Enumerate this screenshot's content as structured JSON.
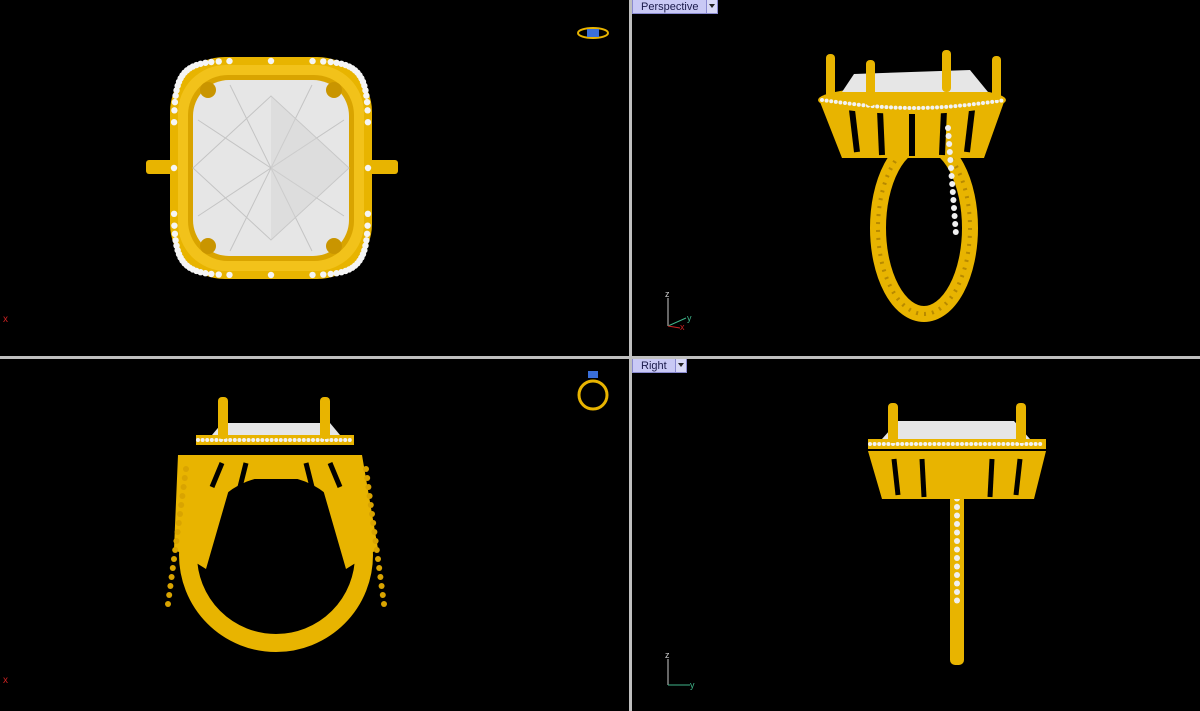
{
  "viewports": {
    "top": {
      "label": "",
      "marker": "x"
    },
    "perspective": {
      "label": "Perspective"
    },
    "front": {
      "label": "",
      "marker": "x"
    },
    "right": {
      "label": "Right"
    }
  },
  "axes": {
    "perspective": {
      "z": "z",
      "y": "y",
      "x": "x"
    },
    "right": {
      "z": "z",
      "y": "y"
    }
  },
  "colors": {
    "background": "#000000",
    "gold": "#E8B400",
    "gold_dark": "#A07800",
    "stone": "#E6E6E6",
    "accent_stone": "#3a6fd8",
    "divider": "#bfbfbf",
    "tab_bg": "#c9c9f5"
  },
  "icons": {
    "tab_dropdown": "chevron-down-icon",
    "mini_preview": "ring-thumbnail-icon"
  }
}
